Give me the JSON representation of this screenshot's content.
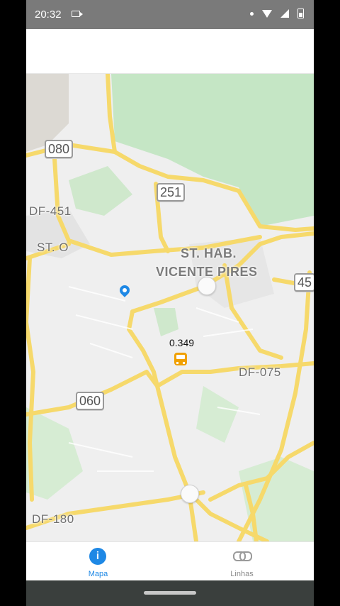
{
  "status_bar": {
    "time": "20:32"
  },
  "map": {
    "road_labels": [
      "080",
      "251",
      "DF-451",
      "060",
      "DF-075",
      "DF-180",
      "45"
    ],
    "place_labels": [
      "ST. O",
      "ST. HAB.",
      "VICENTE PIRES"
    ],
    "bus": {
      "label": "0.349"
    },
    "colors": {
      "road": "#f6d96b",
      "park": "#c5e6c5",
      "base": "#efefef"
    }
  },
  "bottom_nav": {
    "items": [
      {
        "label": "Mapa",
        "icon": "info-icon",
        "active": true,
        "color": "#1e88e5"
      },
      {
        "label": "Linhas",
        "icon": "link-icon",
        "active": false,
        "color": "#8a8a8a"
      }
    ]
  }
}
